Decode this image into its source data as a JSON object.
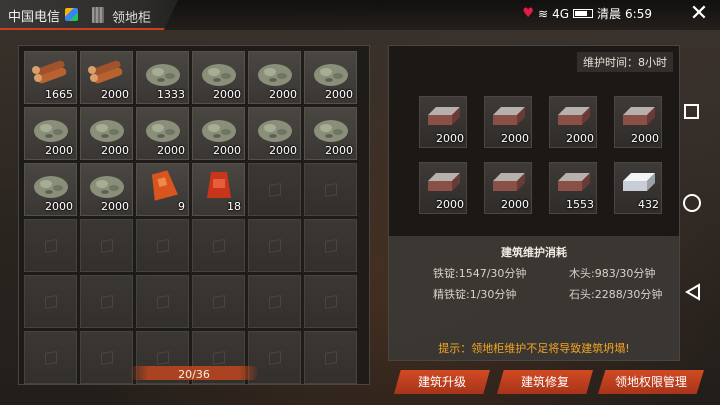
{
  "status_bar": {
    "carrier": "中国电信",
    "network": "4G",
    "signal_text": "清晨",
    "time": "6:59"
  },
  "window": {
    "title": "领地柜",
    "close_icon": "close-icon"
  },
  "storage": {
    "capacity_text": "20/36",
    "slots": [
      {
        "item": "wood-logs",
        "count": "1665"
      },
      {
        "item": "wood-logs",
        "count": "2000"
      },
      {
        "item": "stone-ore",
        "count": "1333"
      },
      {
        "item": "stone-ore",
        "count": "2000"
      },
      {
        "item": "stone-ore",
        "count": "2000"
      },
      {
        "item": "stone-ore",
        "count": "2000"
      },
      {
        "item": "stone-ore",
        "count": "2000"
      },
      {
        "item": "stone-ore",
        "count": "2000"
      },
      {
        "item": "stone-ore",
        "count": "2000"
      },
      {
        "item": "stone-ore",
        "count": "2000"
      },
      {
        "item": "stone-ore",
        "count": "2000"
      },
      {
        "item": "stone-ore",
        "count": "2000"
      },
      {
        "item": "stone-ore",
        "count": "2000"
      },
      {
        "item": "stone-ore",
        "count": "2000"
      },
      {
        "item": "orange-fuel-bag",
        "count": "9"
      },
      {
        "item": "red-fuel-bag",
        "count": "18"
      }
    ],
    "total_slots": 36
  },
  "maintenance": {
    "time_label": "维护时间：8小时",
    "materials": [
      {
        "item": "iron-ingot",
        "count": "2000"
      },
      {
        "item": "iron-ingot",
        "count": "2000"
      },
      {
        "item": "iron-ingot",
        "count": "2000"
      },
      {
        "item": "iron-ingot",
        "count": "2000"
      },
      {
        "item": "iron-ingot",
        "count": "2000"
      },
      {
        "item": "iron-ingot",
        "count": "2000"
      },
      {
        "item": "iron-ingot",
        "count": "1553"
      },
      {
        "item": "refined-iron-ingot",
        "count": "432"
      }
    ],
    "cost_title": "建筑维护消耗",
    "costs": {
      "iron": "铁锭:1547/30分钟",
      "wood": "木头:983/30分钟",
      "refined_iron": "精铁锭:1/30分钟",
      "stone": "石头:2288/30分钟"
    },
    "hint": "提示：领地柜维护不足将导致建筑坍塌!"
  },
  "actions": {
    "upgrade": "建筑升级",
    "repair": "建筑修复",
    "permissions": "领地权限管理"
  },
  "colors": {
    "accent": "#c8401e",
    "hint": "#f4a523"
  }
}
